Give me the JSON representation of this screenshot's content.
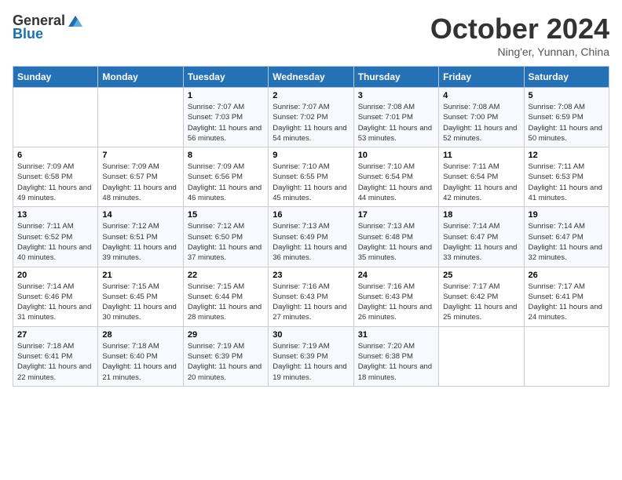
{
  "header": {
    "logo_general": "General",
    "logo_blue": "Blue",
    "title": "October 2024",
    "location": "Ning'er, Yunnan, China"
  },
  "weekdays": [
    "Sunday",
    "Monday",
    "Tuesday",
    "Wednesday",
    "Thursday",
    "Friday",
    "Saturday"
  ],
  "weeks": [
    [
      {
        "day": "",
        "sunrise": "",
        "sunset": "",
        "daylight": ""
      },
      {
        "day": "",
        "sunrise": "",
        "sunset": "",
        "daylight": ""
      },
      {
        "day": "1",
        "sunrise": "Sunrise: 7:07 AM",
        "sunset": "Sunset: 7:03 PM",
        "daylight": "Daylight: 11 hours and 56 minutes."
      },
      {
        "day": "2",
        "sunrise": "Sunrise: 7:07 AM",
        "sunset": "Sunset: 7:02 PM",
        "daylight": "Daylight: 11 hours and 54 minutes."
      },
      {
        "day": "3",
        "sunrise": "Sunrise: 7:08 AM",
        "sunset": "Sunset: 7:01 PM",
        "daylight": "Daylight: 11 hours and 53 minutes."
      },
      {
        "day": "4",
        "sunrise": "Sunrise: 7:08 AM",
        "sunset": "Sunset: 7:00 PM",
        "daylight": "Daylight: 11 hours and 52 minutes."
      },
      {
        "day": "5",
        "sunrise": "Sunrise: 7:08 AM",
        "sunset": "Sunset: 6:59 PM",
        "daylight": "Daylight: 11 hours and 50 minutes."
      }
    ],
    [
      {
        "day": "6",
        "sunrise": "Sunrise: 7:09 AM",
        "sunset": "Sunset: 6:58 PM",
        "daylight": "Daylight: 11 hours and 49 minutes."
      },
      {
        "day": "7",
        "sunrise": "Sunrise: 7:09 AM",
        "sunset": "Sunset: 6:57 PM",
        "daylight": "Daylight: 11 hours and 48 minutes."
      },
      {
        "day": "8",
        "sunrise": "Sunrise: 7:09 AM",
        "sunset": "Sunset: 6:56 PM",
        "daylight": "Daylight: 11 hours and 46 minutes."
      },
      {
        "day": "9",
        "sunrise": "Sunrise: 7:10 AM",
        "sunset": "Sunset: 6:55 PM",
        "daylight": "Daylight: 11 hours and 45 minutes."
      },
      {
        "day": "10",
        "sunrise": "Sunrise: 7:10 AM",
        "sunset": "Sunset: 6:54 PM",
        "daylight": "Daylight: 11 hours and 44 minutes."
      },
      {
        "day": "11",
        "sunrise": "Sunrise: 7:11 AM",
        "sunset": "Sunset: 6:54 PM",
        "daylight": "Daylight: 11 hours and 42 minutes."
      },
      {
        "day": "12",
        "sunrise": "Sunrise: 7:11 AM",
        "sunset": "Sunset: 6:53 PM",
        "daylight": "Daylight: 11 hours and 41 minutes."
      }
    ],
    [
      {
        "day": "13",
        "sunrise": "Sunrise: 7:11 AM",
        "sunset": "Sunset: 6:52 PM",
        "daylight": "Daylight: 11 hours and 40 minutes."
      },
      {
        "day": "14",
        "sunrise": "Sunrise: 7:12 AM",
        "sunset": "Sunset: 6:51 PM",
        "daylight": "Daylight: 11 hours and 39 minutes."
      },
      {
        "day": "15",
        "sunrise": "Sunrise: 7:12 AM",
        "sunset": "Sunset: 6:50 PM",
        "daylight": "Daylight: 11 hours and 37 minutes."
      },
      {
        "day": "16",
        "sunrise": "Sunrise: 7:13 AM",
        "sunset": "Sunset: 6:49 PM",
        "daylight": "Daylight: 11 hours and 36 minutes."
      },
      {
        "day": "17",
        "sunrise": "Sunrise: 7:13 AM",
        "sunset": "Sunset: 6:48 PM",
        "daylight": "Daylight: 11 hours and 35 minutes."
      },
      {
        "day": "18",
        "sunrise": "Sunrise: 7:14 AM",
        "sunset": "Sunset: 6:47 PM",
        "daylight": "Daylight: 11 hours and 33 minutes."
      },
      {
        "day": "19",
        "sunrise": "Sunrise: 7:14 AM",
        "sunset": "Sunset: 6:47 PM",
        "daylight": "Daylight: 11 hours and 32 minutes."
      }
    ],
    [
      {
        "day": "20",
        "sunrise": "Sunrise: 7:14 AM",
        "sunset": "Sunset: 6:46 PM",
        "daylight": "Daylight: 11 hours and 31 minutes."
      },
      {
        "day": "21",
        "sunrise": "Sunrise: 7:15 AM",
        "sunset": "Sunset: 6:45 PM",
        "daylight": "Daylight: 11 hours and 30 minutes."
      },
      {
        "day": "22",
        "sunrise": "Sunrise: 7:15 AM",
        "sunset": "Sunset: 6:44 PM",
        "daylight": "Daylight: 11 hours and 28 minutes."
      },
      {
        "day": "23",
        "sunrise": "Sunrise: 7:16 AM",
        "sunset": "Sunset: 6:43 PM",
        "daylight": "Daylight: 11 hours and 27 minutes."
      },
      {
        "day": "24",
        "sunrise": "Sunrise: 7:16 AM",
        "sunset": "Sunset: 6:43 PM",
        "daylight": "Daylight: 11 hours and 26 minutes."
      },
      {
        "day": "25",
        "sunrise": "Sunrise: 7:17 AM",
        "sunset": "Sunset: 6:42 PM",
        "daylight": "Daylight: 11 hours and 25 minutes."
      },
      {
        "day": "26",
        "sunrise": "Sunrise: 7:17 AM",
        "sunset": "Sunset: 6:41 PM",
        "daylight": "Daylight: 11 hours and 24 minutes."
      }
    ],
    [
      {
        "day": "27",
        "sunrise": "Sunrise: 7:18 AM",
        "sunset": "Sunset: 6:41 PM",
        "daylight": "Daylight: 11 hours and 22 minutes."
      },
      {
        "day": "28",
        "sunrise": "Sunrise: 7:18 AM",
        "sunset": "Sunset: 6:40 PM",
        "daylight": "Daylight: 11 hours and 21 minutes."
      },
      {
        "day": "29",
        "sunrise": "Sunrise: 7:19 AM",
        "sunset": "Sunset: 6:39 PM",
        "daylight": "Daylight: 11 hours and 20 minutes."
      },
      {
        "day": "30",
        "sunrise": "Sunrise: 7:19 AM",
        "sunset": "Sunset: 6:39 PM",
        "daylight": "Daylight: 11 hours and 19 minutes."
      },
      {
        "day": "31",
        "sunrise": "Sunrise: 7:20 AM",
        "sunset": "Sunset: 6:38 PM",
        "daylight": "Daylight: 11 hours and 18 minutes."
      },
      {
        "day": "",
        "sunrise": "",
        "sunset": "",
        "daylight": ""
      },
      {
        "day": "",
        "sunrise": "",
        "sunset": "",
        "daylight": ""
      }
    ]
  ]
}
